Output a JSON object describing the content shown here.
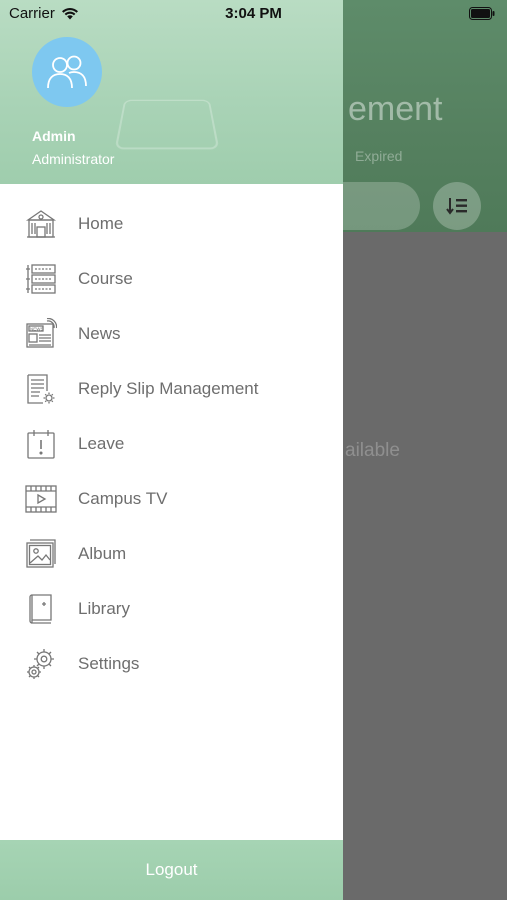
{
  "status_bar": {
    "carrier": "Carrier",
    "time": "3:04 PM"
  },
  "user": {
    "name": "Admin",
    "role": "Administrator"
  },
  "menu": {
    "items": [
      {
        "label": "Home",
        "icon": "home-building-icon"
      },
      {
        "label": "Course",
        "icon": "course-list-icon"
      },
      {
        "label": "News",
        "icon": "news-icon"
      },
      {
        "label": "Reply Slip Management",
        "icon": "reply-slip-icon"
      },
      {
        "label": "Leave",
        "icon": "leave-calendar-icon"
      },
      {
        "label": "Campus TV",
        "icon": "campus-tv-icon"
      },
      {
        "label": "Album",
        "icon": "album-icon"
      },
      {
        "label": "Library",
        "icon": "library-book-icon"
      },
      {
        "label": "Settings",
        "icon": "settings-gear-icon"
      }
    ]
  },
  "logout_label": "Logout",
  "background_page": {
    "title_fragment": "ement",
    "subtitle_fragment": "Expired",
    "empty_fragment": "ailable"
  },
  "colors": {
    "drawer_header": "#a9d3b6",
    "avatar": "#7ec8f0",
    "menu_text": "#6e6e6e",
    "overlay": "#6a6a6a"
  }
}
